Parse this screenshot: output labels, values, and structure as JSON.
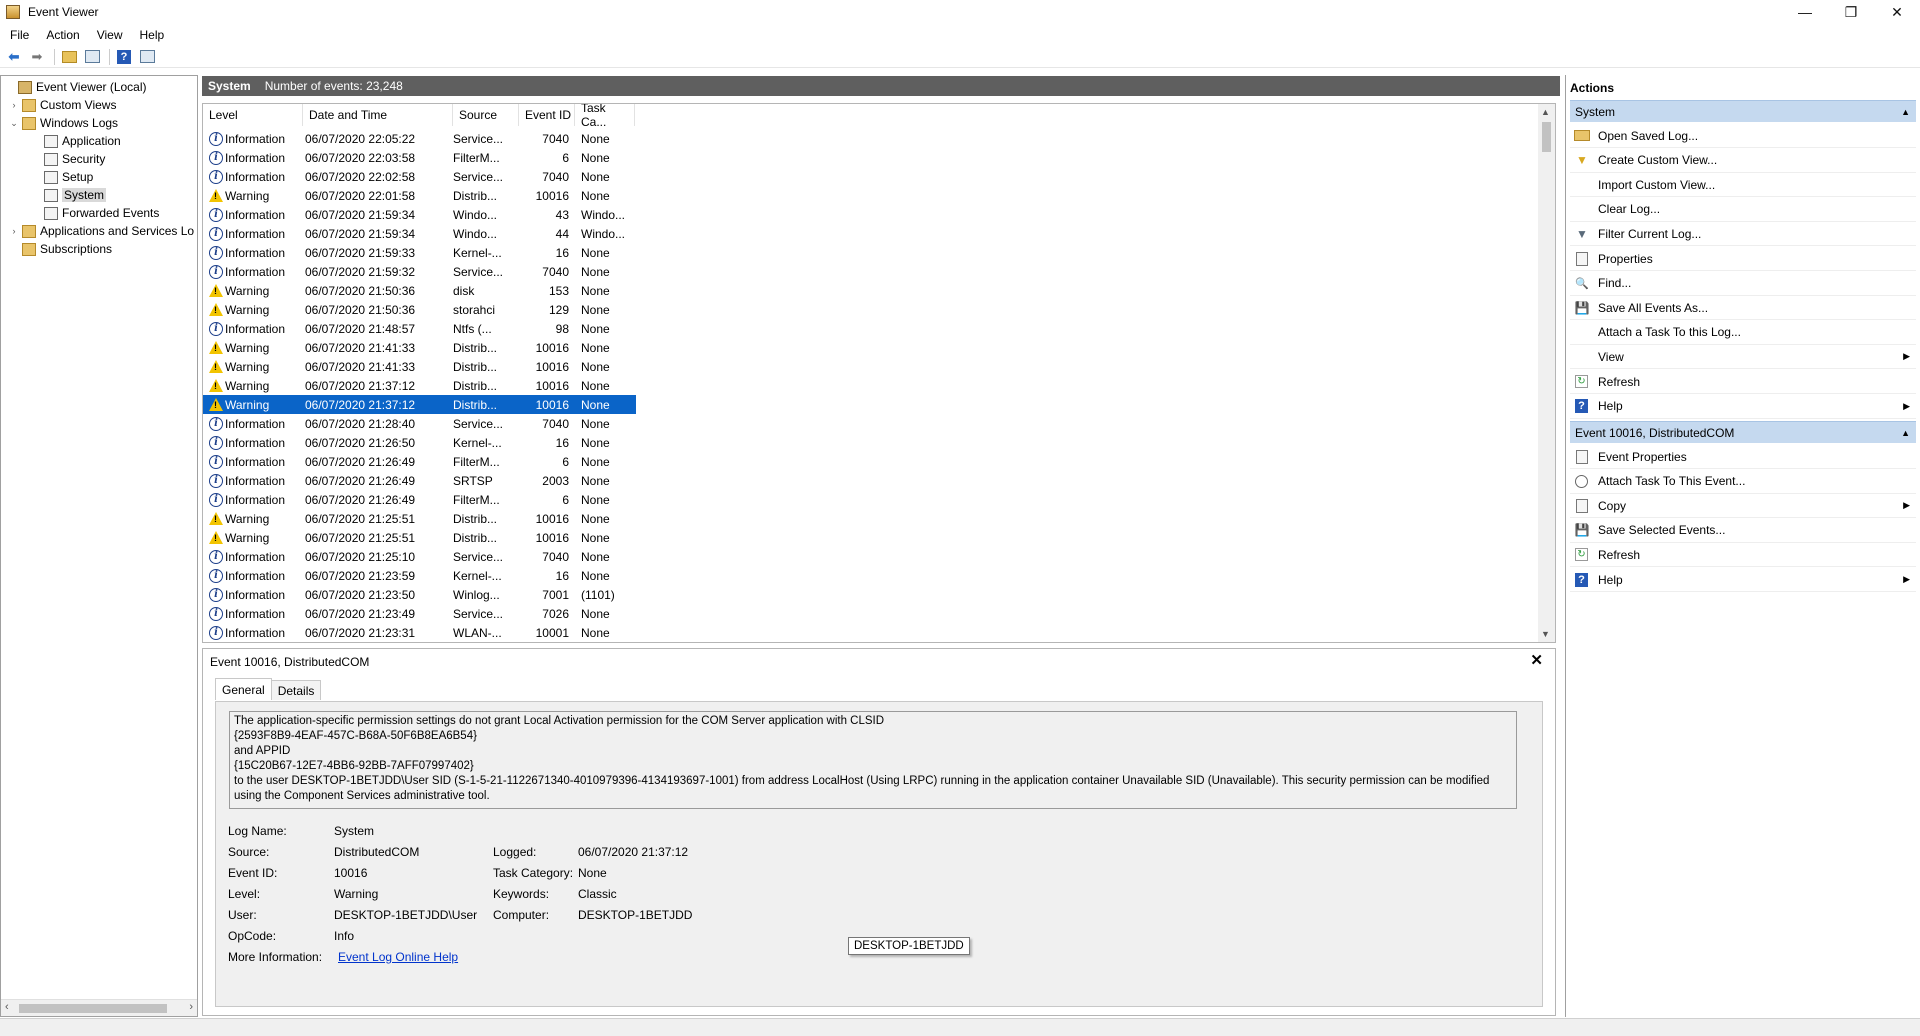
{
  "window": {
    "title": "Event Viewer",
    "minimize": "—",
    "restore": "❐",
    "close": "✕"
  },
  "menu": [
    "File",
    "Action",
    "View",
    "Help"
  ],
  "tree": {
    "items": [
      {
        "label": "Event Viewer (Local)",
        "expander": ""
      },
      {
        "label": "Custom Views",
        "expander": "›"
      },
      {
        "label": "Windows Logs",
        "expander": "⌄"
      },
      {
        "label": "Application",
        "expander": ""
      },
      {
        "label": "Security",
        "expander": ""
      },
      {
        "label": "Setup",
        "expander": ""
      },
      {
        "label": "System",
        "expander": ""
      },
      {
        "label": "Forwarded Events",
        "expander": ""
      },
      {
        "label": "Applications and Services Lo",
        "expander": "›"
      },
      {
        "label": "Subscriptions",
        "expander": ""
      }
    ]
  },
  "center": {
    "log_name": "System",
    "count_text": "Number of events: 23,248"
  },
  "columns": [
    "Level",
    "Date and Time",
    "Source",
    "Event ID",
    "Task Ca..."
  ],
  "events": [
    {
      "level": "Information",
      "date": "06/07/2020 22:05:22",
      "source": "Service...",
      "id": "7040",
      "task": "None"
    },
    {
      "level": "Information",
      "date": "06/07/2020 22:03:58",
      "source": "FilterM...",
      "id": "6",
      "task": "None"
    },
    {
      "level": "Information",
      "date": "06/07/2020 22:02:58",
      "source": "Service...",
      "id": "7040",
      "task": "None"
    },
    {
      "level": "Warning",
      "date": "06/07/2020 22:01:58",
      "source": "Distrib...",
      "id": "10016",
      "task": "None"
    },
    {
      "level": "Information",
      "date": "06/07/2020 21:59:34",
      "source": "Windo...",
      "id": "43",
      "task": "Windo..."
    },
    {
      "level": "Information",
      "date": "06/07/2020 21:59:34",
      "source": "Windo...",
      "id": "44",
      "task": "Windo..."
    },
    {
      "level": "Information",
      "date": "06/07/2020 21:59:33",
      "source": "Kernel-...",
      "id": "16",
      "task": "None"
    },
    {
      "level": "Information",
      "date": "06/07/2020 21:59:32",
      "source": "Service...",
      "id": "7040",
      "task": "None"
    },
    {
      "level": "Warning",
      "date": "06/07/2020 21:50:36",
      "source": "disk",
      "id": "153",
      "task": "None"
    },
    {
      "level": "Warning",
      "date": "06/07/2020 21:50:36",
      "source": "storahci",
      "id": "129",
      "task": "None"
    },
    {
      "level": "Information",
      "date": "06/07/2020 21:48:57",
      "source": "Ntfs (...",
      "id": "98",
      "task": "None"
    },
    {
      "level": "Warning",
      "date": "06/07/2020 21:41:33",
      "source": "Distrib...",
      "id": "10016",
      "task": "None"
    },
    {
      "level": "Warning",
      "date": "06/07/2020 21:41:33",
      "source": "Distrib...",
      "id": "10016",
      "task": "None"
    },
    {
      "level": "Warning",
      "date": "06/07/2020 21:37:12",
      "source": "Distrib...",
      "id": "10016",
      "task": "None"
    },
    {
      "level": "Warning",
      "date": "06/07/2020 21:37:12",
      "source": "Distrib...",
      "id": "10016",
      "task": "None",
      "selected": true
    },
    {
      "level": "Information",
      "date": "06/07/2020 21:28:40",
      "source": "Service...",
      "id": "7040",
      "task": "None"
    },
    {
      "level": "Information",
      "date": "06/07/2020 21:26:50",
      "source": "Kernel-...",
      "id": "16",
      "task": "None"
    },
    {
      "level": "Information",
      "date": "06/07/2020 21:26:49",
      "source": "FilterM...",
      "id": "6",
      "task": "None"
    },
    {
      "level": "Information",
      "date": "06/07/2020 21:26:49",
      "source": "SRTSP",
      "id": "2003",
      "task": "None"
    },
    {
      "level": "Information",
      "date": "06/07/2020 21:26:49",
      "source": "FilterM...",
      "id": "6",
      "task": "None"
    },
    {
      "level": "Warning",
      "date": "06/07/2020 21:25:51",
      "source": "Distrib...",
      "id": "10016",
      "task": "None"
    },
    {
      "level": "Warning",
      "date": "06/07/2020 21:25:51",
      "source": "Distrib...",
      "id": "10016",
      "task": "None"
    },
    {
      "level": "Information",
      "date": "06/07/2020 21:25:10",
      "source": "Service...",
      "id": "7040",
      "task": "None"
    },
    {
      "level": "Information",
      "date": "06/07/2020 21:23:59",
      "source": "Kernel-...",
      "id": "16",
      "task": "None"
    },
    {
      "level": "Information",
      "date": "06/07/2020 21:23:50",
      "source": "Winlog...",
      "id": "7001",
      "task": "(1101)"
    },
    {
      "level": "Information",
      "date": "06/07/2020 21:23:49",
      "source": "Service...",
      "id": "7026",
      "task": "None"
    },
    {
      "level": "Information",
      "date": "06/07/2020 21:23:31",
      "source": "WLAN-...",
      "id": "10001",
      "task": "None"
    }
  ],
  "detail": {
    "title": "Event 10016, DistributedCOM",
    "tabs": [
      "General",
      "Details"
    ],
    "message_lines": [
      "The application-specific permission settings do not grant Local Activation permission for the COM Server application with CLSID",
      "{2593F8B9-4EAF-457C-B68A-50F6B8EA6B54}",
      " and APPID",
      "{15C20B67-12E7-4BB6-92BB-7AFF07997402}",
      " to the user DESKTOP-1BETJDD\\User SID (S-1-5-21-1122671340-4010979396-4134193697-1001) from address LocalHost (Using LRPC) running in the application container Unavailable SID (Unavailable). This security permission can be modified",
      "using the Component Services administrative tool."
    ],
    "labels": {
      "log_name": "Log Name:",
      "source": "Source:",
      "event_id": "Event ID:",
      "level": "Level:",
      "user": "User:",
      "opcode": "OpCode:",
      "more_info": "More Information:",
      "logged": "Logged:",
      "task_category": "Task Category:",
      "keywords": "Keywords:",
      "computer": "Computer:"
    },
    "values": {
      "log_name": "System",
      "source": "DistributedCOM",
      "event_id": "10016",
      "level": "Warning",
      "user": "DESKTOP-1BETJDD\\User",
      "opcode": "Info",
      "more_info": "Event Log Online Help",
      "logged": "06/07/2020 21:37:12",
      "task_category": "None",
      "keywords": "Classic",
      "computer": "DESKTOP-1BETJDD"
    },
    "tooltip": "DESKTOP-1BETJDD"
  },
  "actions": {
    "header": "Actions",
    "section1": "System",
    "items1": [
      {
        "label": "Open Saved Log...",
        "icon": "folder-icon",
        "submenu": false
      },
      {
        "label": "Create Custom View...",
        "icon": "funnel-icon",
        "submenu": false
      },
      {
        "label": "Import Custom View...",
        "icon": "",
        "submenu": false
      },
      {
        "label": "Clear Log...",
        "icon": "",
        "submenu": false
      },
      {
        "label": "Filter Current Log...",
        "icon": "filter-icon",
        "submenu": false
      },
      {
        "label": "Properties",
        "icon": "properties-icon",
        "submenu": false
      },
      {
        "label": "Find...",
        "icon": "find-icon",
        "submenu": false
      },
      {
        "label": "Save All Events As...",
        "icon": "save-icon",
        "submenu": false
      },
      {
        "label": "Attach a Task To this Log...",
        "icon": "",
        "submenu": false
      },
      {
        "label": "View",
        "icon": "",
        "submenu": true
      },
      {
        "label": "Refresh",
        "icon": "refresh-icon",
        "submenu": false
      },
      {
        "label": "Help",
        "icon": "help-icon",
        "submenu": true
      }
    ],
    "section2": "Event 10016, DistributedCOM",
    "items2": [
      {
        "label": "Event Properties",
        "icon": "properties-icon",
        "submenu": false
      },
      {
        "label": "Attach Task To This Event...",
        "icon": "clock-icon",
        "submenu": false
      },
      {
        "label": "Copy",
        "icon": "copy-icon",
        "submenu": true
      },
      {
        "label": "Save Selected Events...",
        "icon": "save-icon",
        "submenu": false
      },
      {
        "label": "Refresh",
        "icon": "refresh-icon",
        "submenu": false
      },
      {
        "label": "Help",
        "icon": "help-icon",
        "submenu": true
      }
    ]
  }
}
